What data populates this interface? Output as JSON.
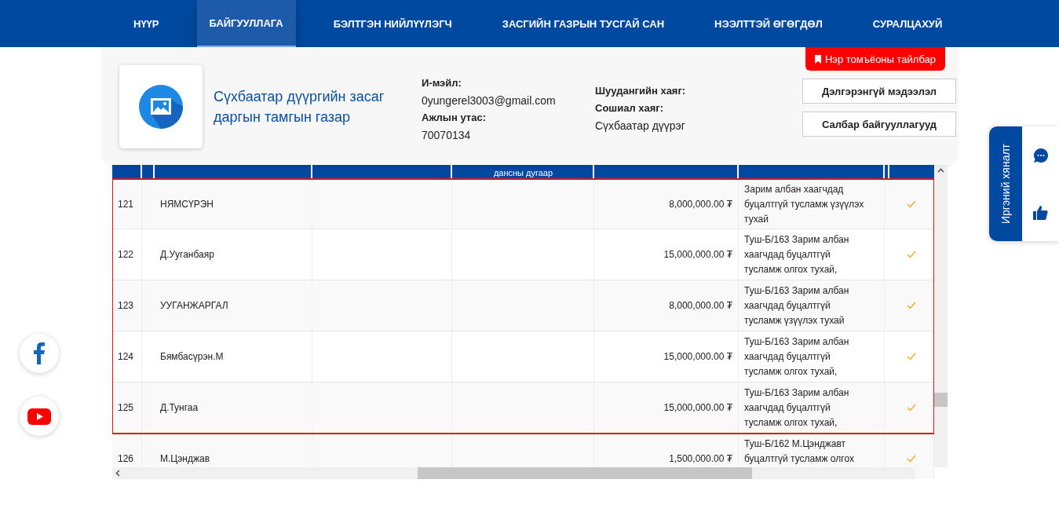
{
  "nav": [
    {
      "label": "НҮҮР",
      "selected": false
    },
    {
      "label": "БАЙГУУЛЛАГА",
      "selected": true
    },
    {
      "label": "БЭЛТГЭН НИЙЛҮҮЛЭГЧ",
      "selected": false
    },
    {
      "label": "ЗАСГИЙН ГАЗРЫН ТУСГАЙ САН",
      "selected": false
    },
    {
      "label": "НЭЭЛТТЭЙ ӨГӨГДӨЛ",
      "selected": false
    },
    {
      "label": "СУРАЛЦАХУЙ",
      "selected": false
    }
  ],
  "organization": {
    "name": "Сүхбаатар дүүргийн засаг даргын тамгын газар",
    "email_label": "И-мэйл:",
    "email": "0yungerel3003@gmail.com",
    "phone_label": "Ажлын утас:",
    "phone": "70070134",
    "mail_label": "Шуудангийн хаяг:",
    "social_label": "Сошиал хаяг:",
    "address": "Сүхбаатар дүүрэг",
    "legend_button": "Нэр томъёоны тайлбар",
    "buttons": [
      "Дэлгэрэнгүй мэдээлэл",
      "Салбар байгууллагууд"
    ]
  },
  "table": {
    "header_text": "дансны дугаар",
    "rows": [
      {
        "no": "121",
        "name": "НЯМСҮРЭН",
        "amount": "8,000,000.00 ₮",
        "description": "Зарим албан хаагчдад буцалтгүй тусламж үзүүлэх тухай",
        "checked": true,
        "highlighted": true
      },
      {
        "no": "122",
        "name": "Д.Ууганбаяр",
        "amount": "15,000,000.00 ₮",
        "description": "Туш-Б/163 Зарим албан хаагчдад буцалтгүй тусламж олгох тухай,",
        "checked": true,
        "highlighted": true
      },
      {
        "no": "123",
        "name": "УУГАНЖАРГАЛ",
        "amount": "8,000,000.00 ₮",
        "description": "Туш-Б/163 Зарим албан хаагчдад буцалтгүй тусламж үзүүлэх тухай",
        "checked": true,
        "highlighted": true
      },
      {
        "no": "124",
        "name": "Бямбасүрэн.М",
        "amount": "15,000,000.00 ₮",
        "description": "Туш-Б/163 Зарим албан хаагчдад буцалтгүй тусламж олгох тухай,",
        "checked": true,
        "highlighted": true
      },
      {
        "no": "125",
        "name": "Д.Тунгаа",
        "amount": "15,000,000.00 ₮",
        "description": "Туш-Б/163 Зарим албан хаагчдад буцалтгүй тусламж олгох тухай,",
        "checked": true,
        "highlighted": true
      },
      {
        "no": "126",
        "name": "М.Цэнджав",
        "amount": "1,500,000.00 ₮",
        "description": "Туш-Б/162 М.Цэнджавт буцалтгүй тусламж олгох",
        "checked": true,
        "highlighted": false
      }
    ]
  },
  "feedback_panel": {
    "label": "Иргэний хяналт"
  }
}
